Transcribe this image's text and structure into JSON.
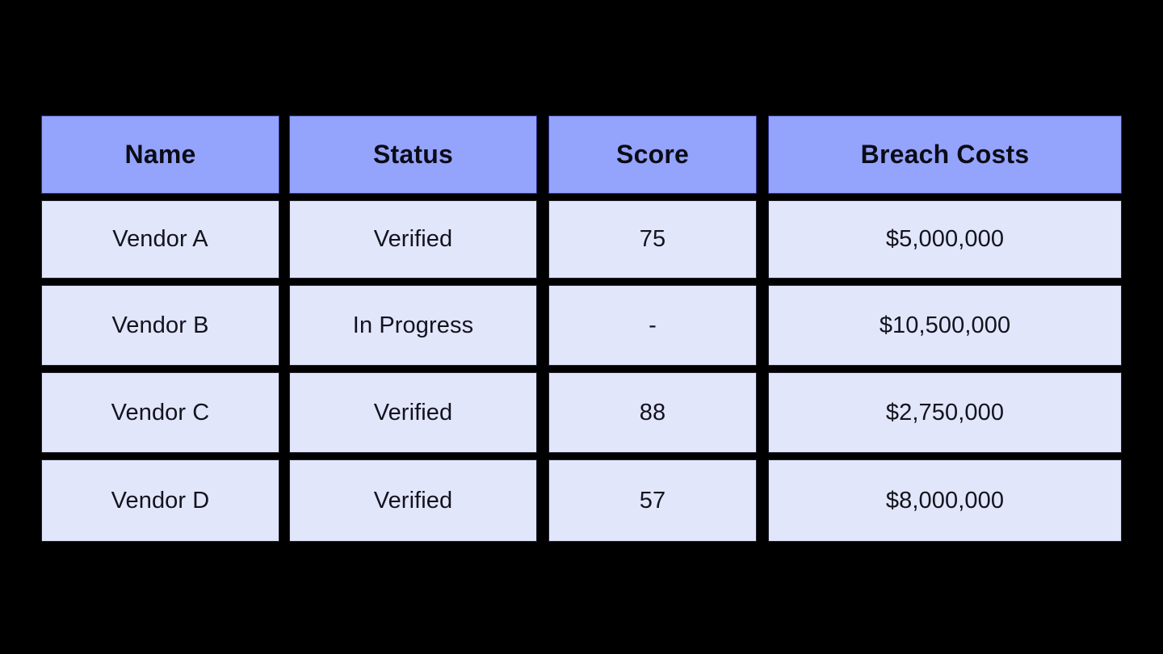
{
  "table": {
    "columns": [
      {
        "key": "name",
        "label": "Name"
      },
      {
        "key": "status",
        "label": "Status"
      },
      {
        "key": "score",
        "label": "Score"
      },
      {
        "key": "breach_costs",
        "label": "Breach Costs"
      }
    ],
    "rows": [
      {
        "name": "Vendor A",
        "status": "Verified",
        "score": "75",
        "breach_costs": "$5,000,000"
      },
      {
        "name": "Vendor B",
        "status": "In Progress",
        "score": "-",
        "breach_costs": "$10,500,000"
      },
      {
        "name": "Vendor C",
        "status": "Verified",
        "score": "88",
        "breach_costs": "$2,750,000"
      },
      {
        "name": "Vendor D",
        "status": "Verified",
        "score": "57",
        "breach_costs": "$8,000,000"
      }
    ]
  },
  "colors": {
    "background": "#000000",
    "header_fill": "#94A4FD",
    "header_border": "#2F2F8F",
    "header_text": "#0B0B16",
    "cell_fill": "#E2E6FB",
    "cell_border": "#20202E",
    "cell_text": "#13131D"
  }
}
